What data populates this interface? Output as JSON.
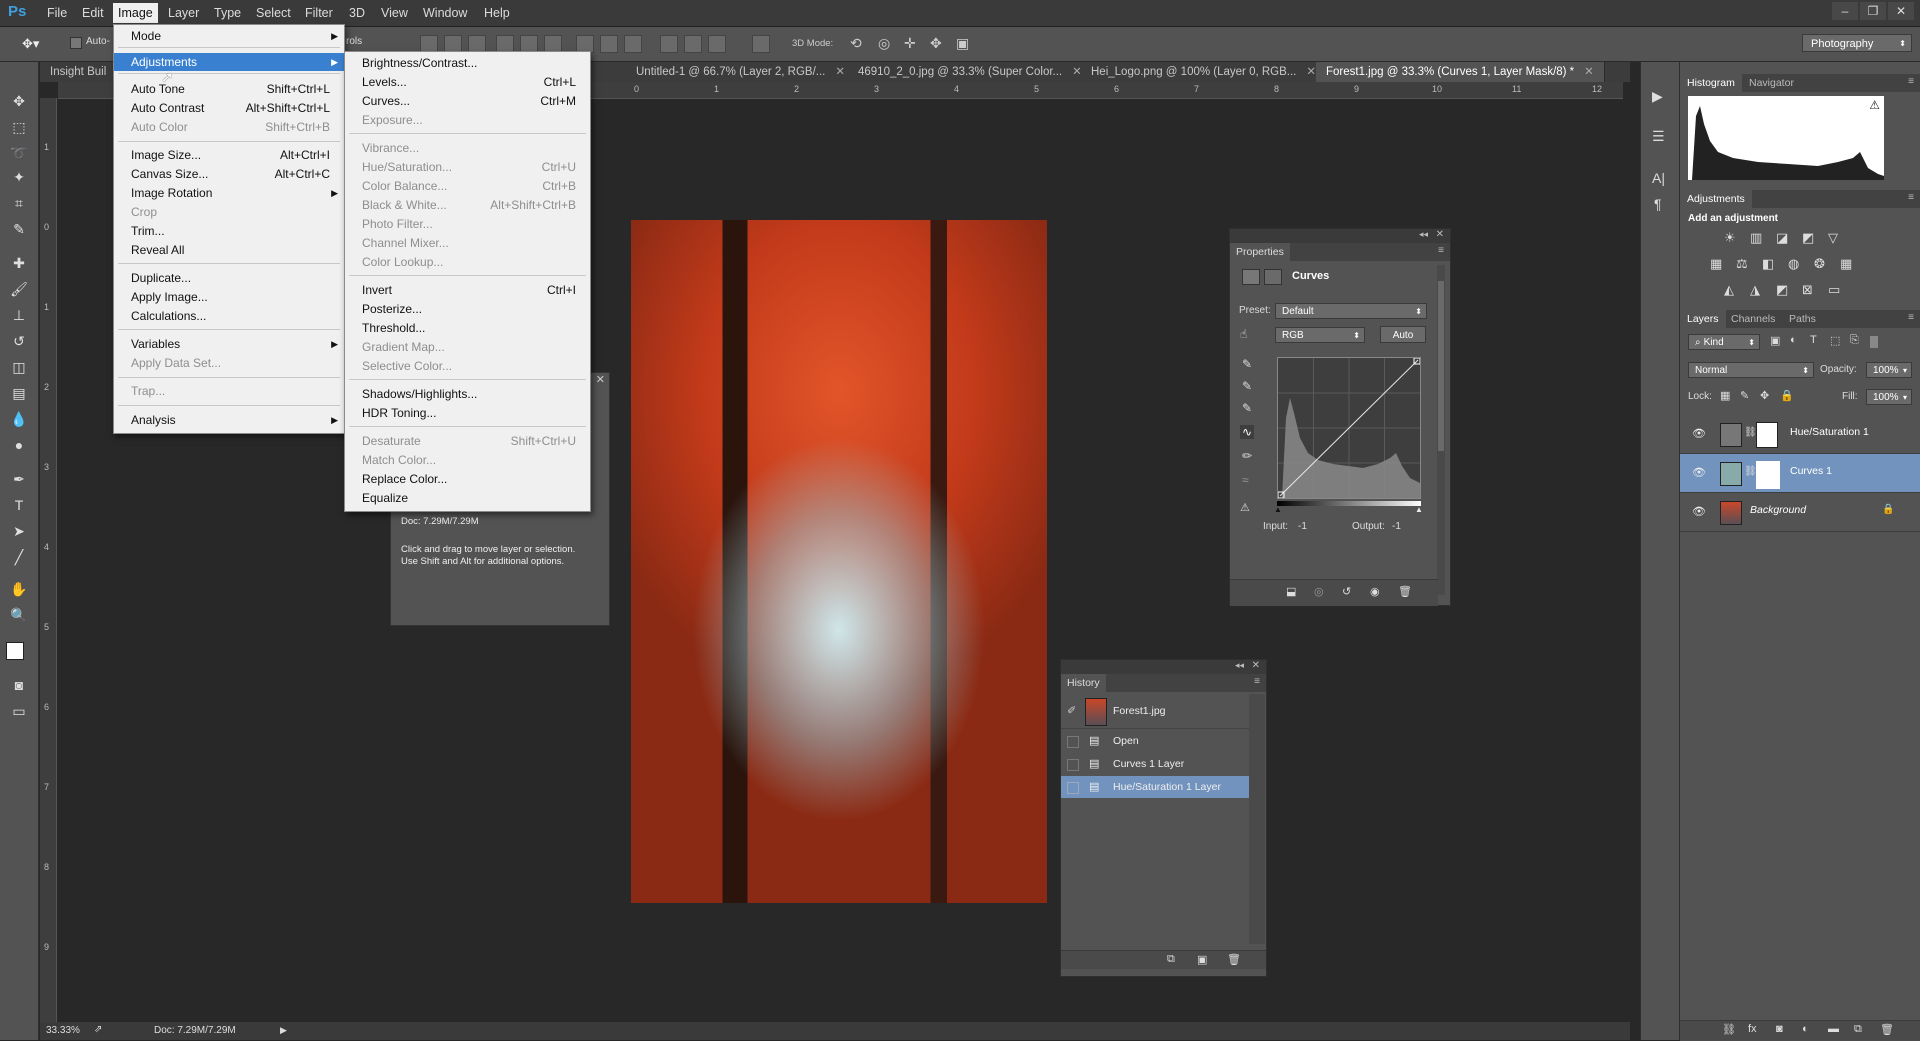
{
  "app": {
    "logo": "Ps"
  },
  "menubar": {
    "items": [
      "File",
      "Edit",
      "Image",
      "Layer",
      "Type",
      "Select",
      "Filter",
      "3D",
      "View",
      "Window",
      "Help"
    ],
    "active": "Image"
  },
  "window_controls": [
    "–",
    "❐",
    "✕"
  ],
  "options_bar": {
    "auto_select_label": "Auto-",
    "truncated_label": "rols",
    "mode_3d_label": "3D Mode:",
    "workspace": "Photography"
  },
  "tabs": [
    {
      "label": "Insight Buil",
      "closable": false
    },
    {
      "label": "Untitled-1 @ 66.7% (Layer 2, RGB/...",
      "closable": true
    },
    {
      "label": "46910_2_0.jpg @ 33.3% (Super Color...",
      "closable": true
    },
    {
      "label": "Hei_Logo.png @ 100% (Layer 0, RGB...",
      "closable": true
    },
    {
      "label": "Forest1.jpg @ 33.3% (Curves 1, Layer Mask/8) *",
      "closable": true,
      "active": true
    }
  ],
  "ruler_top": [
    "0",
    "1",
    "2",
    "3",
    "4",
    "5",
    "6",
    "7",
    "8",
    "9",
    "10",
    "11",
    "12"
  ],
  "ruler_left": [
    "1",
    "0",
    "1",
    "2",
    "3",
    "4",
    "5",
    "6",
    "7",
    "8",
    "9"
  ],
  "image_menu": {
    "items": [
      {
        "label": "Mode",
        "submenu": true
      },
      {
        "label": "Adjustments",
        "submenu": true,
        "highlighted": true
      },
      {
        "label": "Auto Tone",
        "shortcut": "Shift+Ctrl+L"
      },
      {
        "label": "Auto Contrast",
        "shortcut": "Alt+Shift+Ctrl+L"
      },
      {
        "label": "Auto Color",
        "shortcut": "Shift+Ctrl+B",
        "disabled": true
      },
      {
        "label": "Image Size...",
        "shortcut": "Alt+Ctrl+I"
      },
      {
        "label": "Canvas Size...",
        "shortcut": "Alt+Ctrl+C"
      },
      {
        "label": "Image Rotation",
        "submenu": true
      },
      {
        "label": "Crop",
        "disabled": true
      },
      {
        "label": "Trim..."
      },
      {
        "label": "Reveal All"
      },
      {
        "label": "Duplicate..."
      },
      {
        "label": "Apply Image..."
      },
      {
        "label": "Calculations..."
      },
      {
        "label": "Variables",
        "submenu": true
      },
      {
        "label": "Apply Data Set...",
        "disabled": true
      },
      {
        "label": "Trap...",
        "disabled": true
      },
      {
        "label": "Analysis",
        "submenu": true
      }
    ]
  },
  "adjustments_menu": {
    "items": [
      {
        "label": "Brightness/Contrast..."
      },
      {
        "label": "Levels...",
        "shortcut": "Ctrl+L"
      },
      {
        "label": "Curves...",
        "shortcut": "Ctrl+M"
      },
      {
        "label": "Exposure...",
        "disabled": true
      },
      {
        "label": "Vibrance...",
        "disabled": true
      },
      {
        "label": "Hue/Saturation...",
        "shortcut": "Ctrl+U",
        "disabled": true
      },
      {
        "label": "Color Balance...",
        "shortcut": "Ctrl+B",
        "disabled": true
      },
      {
        "label": "Black & White...",
        "shortcut": "Alt+Shift+Ctrl+B",
        "disabled": true
      },
      {
        "label": "Photo Filter...",
        "disabled": true
      },
      {
        "label": "Channel Mixer...",
        "disabled": true
      },
      {
        "label": "Color Lookup...",
        "disabled": true
      },
      {
        "label": "Invert",
        "shortcut": "Ctrl+I"
      },
      {
        "label": "Posterize..."
      },
      {
        "label": "Threshold..."
      },
      {
        "label": "Gradient Map...",
        "disabled": true
      },
      {
        "label": "Selective Color...",
        "disabled": true
      },
      {
        "label": "Shadows/Highlights..."
      },
      {
        "label": "HDR Toning..."
      },
      {
        "label": "Desaturate",
        "shortcut": "Shift+Ctrl+U",
        "disabled": true
      },
      {
        "label": "Match Color...",
        "disabled": true
      },
      {
        "label": "Replace Color..."
      },
      {
        "label": "Equalize"
      }
    ]
  },
  "info_panel": {
    "doc": "Doc: 7.29M/7.29M",
    "hint_line1": "Click and drag to move layer or selection.",
    "hint_line2": "Use Shift and Alt for additional options."
  },
  "properties": {
    "tab": "Properties",
    "type": "Curves",
    "preset_label": "Preset:",
    "preset_value": "Default",
    "channel": "RGB",
    "auto_button": "Auto",
    "input_label": "Input:",
    "input_value": "-1",
    "output_label": "Output:",
    "output_value": "-1"
  },
  "history": {
    "tab": "History",
    "snapshot": "Forest1.jpg",
    "items": [
      "Open",
      "Curves 1 Layer",
      "Hue/Saturation 1 Layer"
    ],
    "selected": 2
  },
  "right_dock": {
    "histogram_tabs": [
      "Histogram",
      "Navigator"
    ],
    "adjustments_tab": "Adjustments",
    "add_adjustment": "Add an adjustment",
    "layer_tabs": [
      "Layers",
      "Channels",
      "Paths"
    ],
    "kind_label": "Kind",
    "blend_mode": "Normal",
    "opacity_label": "Opacity:",
    "opacity_value": "100%",
    "lock_label": "Lock:",
    "fill_label": "Fill:",
    "fill_value": "100%",
    "layers": [
      {
        "name": "Hue/Saturation 1"
      },
      {
        "name": "Curves 1",
        "selected": true
      },
      {
        "name": "Background",
        "locked": true
      }
    ]
  },
  "status": {
    "zoom": "33.33%",
    "doc": "Doc: 7.29M/7.29M"
  }
}
